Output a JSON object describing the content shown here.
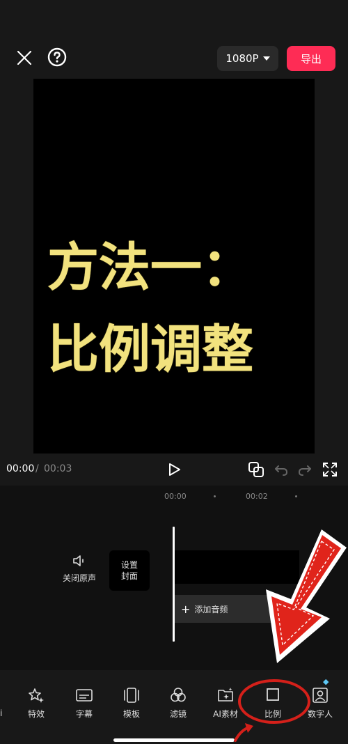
{
  "header": {
    "resolution_label": "1080P",
    "export_label": "导出"
  },
  "preview": {
    "line1": "方法一：",
    "line2": "比例调整"
  },
  "playback": {
    "current_time": "00:00",
    "separator": "/",
    "total_time": "00:03"
  },
  "timeline": {
    "ruler_labels": [
      "00:00",
      "00:02"
    ],
    "mute_label": "关闭原声",
    "cover_line1": "设置",
    "cover_line2": "封面",
    "add_audio_label": "添加音频"
  },
  "toolbar": {
    "cut_partial": "i",
    "items": [
      {
        "label": "特效",
        "icon": "star-sparkle-icon"
      },
      {
        "label": "字幕",
        "icon": "subtitle-icon"
      },
      {
        "label": "模板",
        "icon": "template-icon"
      },
      {
        "label": "滤镜",
        "icon": "filter-icon"
      },
      {
        "label": "AI素材",
        "icon": "ai-material-icon"
      },
      {
        "label": "比例",
        "icon": "ratio-icon"
      },
      {
        "label": "数字人",
        "icon": "digital-human-icon"
      }
    ]
  },
  "colors": {
    "export": "#fe2c55",
    "preview_text": "#f2e27e",
    "annotation": "#e0241b"
  }
}
